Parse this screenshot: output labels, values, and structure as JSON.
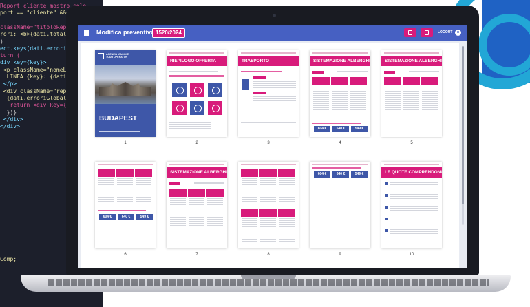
{
  "code_editor": {
    "lines": [
      {
        "text": "Report cliente mostro solo",
        "color": "#e0559a"
      },
      {
        "text": "port == \"cliente\" && dati.e",
        "color": "#e9e3a5"
      },
      {
        "text": "",
        "color": "#ffffff"
      },
      {
        "text": "className=\"titoloReport ti",
        "color": "#e0559a"
      },
      {
        "text": "rori: <b>{dati.totaleErron",
        "color": "#e9e3a5"
      },
      {
        "text": ")",
        "color": "#cfcfcf"
      },
      {
        "text": "ect.keys(dati.erroriGlobal",
        "color": "#78d8ff"
      },
      {
        "text": "turn (",
        "color": "#e0559a"
      },
      {
        "text": "div key={key}>",
        "color": "#78d8ff"
      },
      {
        "text": " <p className=\"nomeLinea\"",
        "color": "#e9e3a5"
      },
      {
        "text": "  LINEA {key}: {dati.err",
        "color": "#e9e3a5"
      },
      {
        "text": " </p>",
        "color": "#78d8ff"
      },
      {
        "text": " <div className=\"reportBo",
        "color": "#e9e3a5"
      },
      {
        "text": "  {dati.erroriGlobali[ke",
        "color": "#e9e3a5"
      },
      {
        "text": "   return <div key={el}",
        "color": "#e0559a"
      },
      {
        "text": "  })}",
        "color": "#cfcfcf"
      },
      {
        "text": " </div>",
        "color": "#78d8ff"
      },
      {
        "text": "</div>",
        "color": "#78d8ff"
      },
      {
        "text": "Comp;",
        "color": "#e9e3a5"
      }
    ]
  },
  "header": {
    "title": "Modifica preventivo",
    "doc_number": "1520/2024",
    "logout_label": "LOGOUT",
    "color": "#4660c2",
    "accent": "#d81b7b"
  },
  "pages": [
    {
      "number": "1",
      "kind": "cover",
      "title": "",
      "cover": {
        "brand": "AGENZIA VIAGGI E TOUR OPERATOR",
        "city": "BUDAPEST"
      }
    },
    {
      "number": "2",
      "kind": "summary",
      "title": "RIEPILOGO OFFERTA"
    },
    {
      "number": "3",
      "kind": "transport",
      "title": "TRASPORTO"
    },
    {
      "number": "4",
      "kind": "hotel",
      "title": "SISTEMAZIONE ALBERGHIERA",
      "prices": [
        "604 €",
        "640 €",
        "549 €"
      ]
    },
    {
      "number": "5",
      "kind": "hotel",
      "title": "SISTEMAZIONE ALBERGHIERA",
      "prices": []
    },
    {
      "number": "6",
      "kind": "hotel-cont",
      "title": "",
      "prices": [
        "604 €",
        "640 €",
        "549 €"
      ]
    },
    {
      "number": "7",
      "kind": "hotel",
      "title": "SISTEMAZIONE ALBERGHIERA",
      "prices": []
    },
    {
      "number": "8",
      "kind": "hotel-cont",
      "title": "",
      "prices": []
    },
    {
      "number": "9",
      "kind": "prices",
      "title": "",
      "prices": [
        "604 €",
        "640 €",
        "549 €"
      ]
    },
    {
      "number": "10",
      "kind": "quotes",
      "title": "LE QUOTE COMPRENDONO"
    }
  ]
}
